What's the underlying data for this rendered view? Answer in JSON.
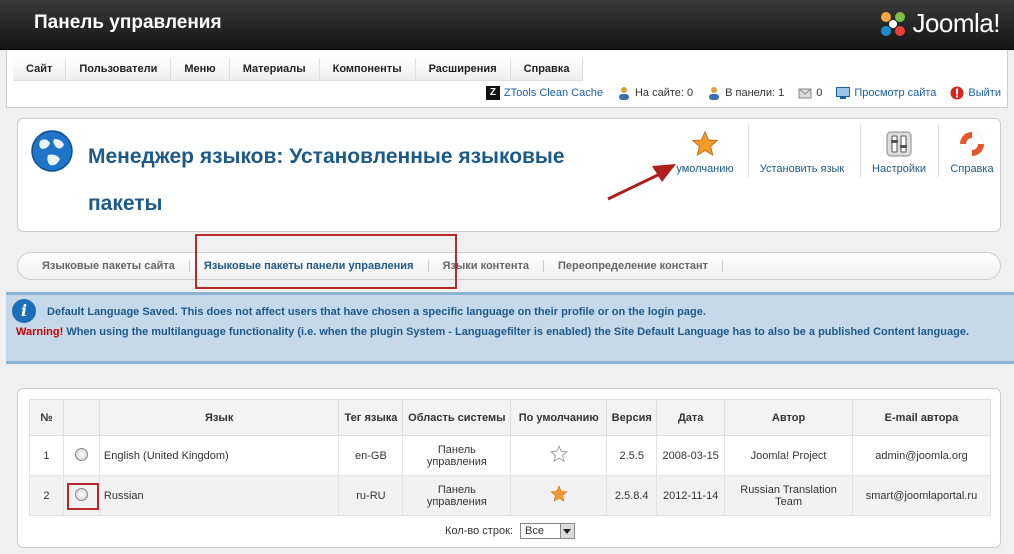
{
  "header": {
    "title": "Панель управления",
    "logo_text": "Joomla!"
  },
  "menu": {
    "items": [
      {
        "label": "Сайт"
      },
      {
        "label": "Пользователи"
      },
      {
        "label": "Меню"
      },
      {
        "label": "Материалы"
      },
      {
        "label": "Компоненты"
      },
      {
        "label": "Расширения"
      },
      {
        "label": "Справка"
      }
    ]
  },
  "status": {
    "ztools": "ZTools Clean Cache",
    "on_site": "На сайте: 0",
    "in_panel": "В панели: 1",
    "messages": "0",
    "view_site": "Просмотр сайта",
    "logout": "Выйти"
  },
  "toolbar": {
    "title": "Менеджер языков: Установленные языковые пакеты",
    "default_label": "умолчанию",
    "install_label": "Установить язык",
    "options_label": "Настройки",
    "help_label": "Справка"
  },
  "tabs": [
    {
      "label": "Языковые пакеты сайта"
    },
    {
      "label": "Языковые пакеты панели управления"
    },
    {
      "label": "Языки контента"
    },
    {
      "label": "Переопределение констант"
    }
  ],
  "message": {
    "line1": "Default Language Saved. This does not affect users that have chosen a specific language on their profile or on the login page.",
    "warning_label": "Warning!",
    "line2": "When using the multilanguage functionality (i.e. when the plugin System - Languagefilter is enabled) the Site Default Language has to also be a published Content language."
  },
  "table": {
    "headers": {
      "num": "№",
      "language": "Язык",
      "tag": "Тег языка",
      "area": "Область системы",
      "default": "По умолчанию",
      "version": "Версия",
      "date": "Дата",
      "author": "Автор",
      "email": "E-mail автора"
    },
    "rows": [
      {
        "num": "1",
        "language": "English (United Kingdom)",
        "tag": "en-GB",
        "area": "Панель управления",
        "default": "no",
        "version": "2.5.5",
        "date": "2008-03-15",
        "author": "Joomla! Project",
        "email": "admin@joomla.org"
      },
      {
        "num": "2",
        "language": "Russian",
        "tag": "ru-RU",
        "area": "Панель управления",
        "default": "yes",
        "version": "2.5.8.4",
        "date": "2012-11-14",
        "author": "Russian Translation Team",
        "email": "smart@joomlaportal.ru"
      }
    ],
    "pager_label": "Кол-во строк:",
    "pager_value": "Все"
  },
  "colors": {
    "accent": "#1d5a8a",
    "highlight": "#b82a2a",
    "star": "#f08a1c"
  }
}
